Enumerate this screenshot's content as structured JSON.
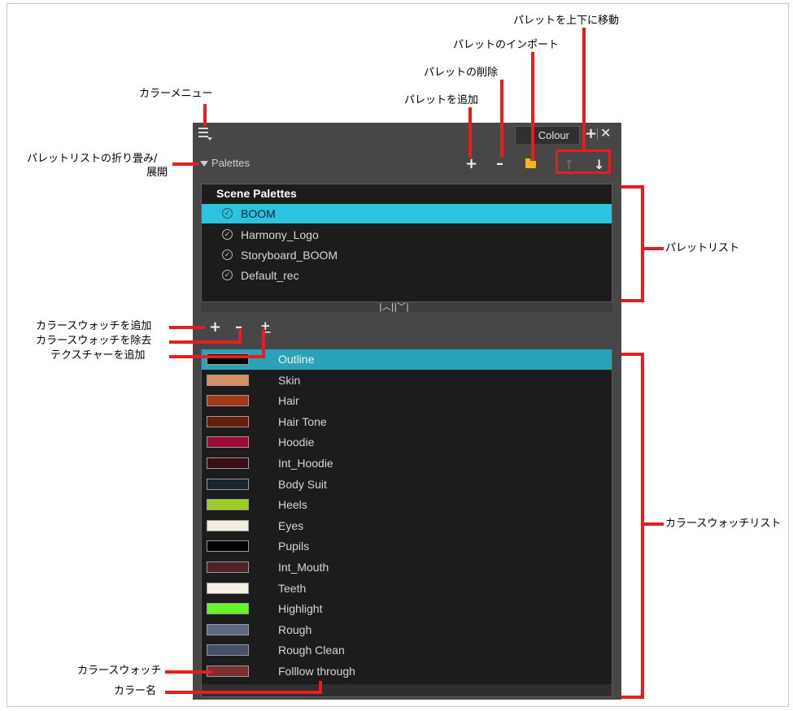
{
  "panel": {
    "tab_label": "Colour",
    "tab_add": "+",
    "tab_close": "✕",
    "palettes_label": "Palettes",
    "toolbar": {
      "add": "+",
      "remove": "–",
      "move_up": "↑",
      "move_down": "↓"
    }
  },
  "palette_list": {
    "section_title": "Scene Palettes",
    "items": [
      {
        "label": "BOOM",
        "selected": true
      },
      {
        "label": "Harmony_Logo",
        "selected": false
      },
      {
        "label": "Storyboard_BOOM",
        "selected": false
      },
      {
        "label": "Default_rec",
        "selected": false
      }
    ],
    "splitter_icons": "|︿||﹀|"
  },
  "swatch_toolbar": {
    "add": "+",
    "remove": "–",
    "texture": "+̲"
  },
  "swatches": [
    {
      "name": "Outline",
      "color": "#000000",
      "selected": true
    },
    {
      "name": "Skin",
      "color": "#d48f63"
    },
    {
      "name": "Hair",
      "color": "#a53815"
    },
    {
      "name": "Hair Tone",
      "color": "#661d0c"
    },
    {
      "name": "Hoodie",
      "color": "#9e0a33"
    },
    {
      "name": "Int_Hoodie",
      "color": "#3d0d14"
    },
    {
      "name": "Body Suit",
      "color": "#1a2530"
    },
    {
      "name": "Heels",
      "color": "#9ccd25"
    },
    {
      "name": "Eyes",
      "color": "#f3ede0"
    },
    {
      "name": "Pupils",
      "color": "#000000"
    },
    {
      "name": "Int_Mouth",
      "color": "#4e2226"
    },
    {
      "name": "Teeth",
      "color": "#f4f0e6"
    },
    {
      "name": "Highlight",
      "color": "#65f524"
    },
    {
      "name": "Rough",
      "color": "#5d6984"
    },
    {
      "name": "Rough Clean",
      "color": "#454f66"
    },
    {
      "name": "Folllow through",
      "color": "#7a2e2e"
    }
  ],
  "annotations": {
    "move_palette": "パレットを上下に移動",
    "import_palette": "パレットのインポート",
    "delete_palette": "パレットの削除",
    "add_palette": "パレットを追加",
    "colour_menu": "カラーメニュー",
    "collapse_line1": "パレットリストの折り畳み/",
    "collapse_line2": "展開",
    "palette_list": "パレットリスト",
    "add_swatch": "カラースウォッチを追加",
    "remove_swatch": "カラースウォッチを除去",
    "add_texture": "テクスチャーを追加",
    "swatch_list": "カラースウォッチリスト",
    "swatch": "カラースウォッチ",
    "colour_name": "カラー名"
  },
  "accent_color": "#e81e1e"
}
